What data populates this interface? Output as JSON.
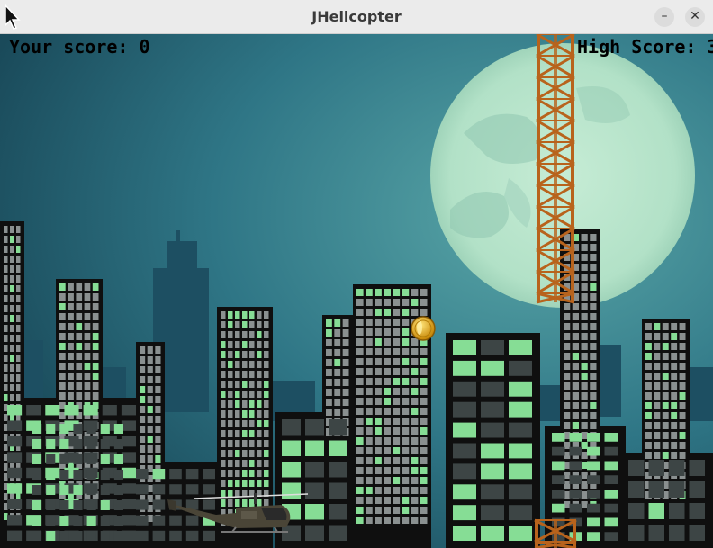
{
  "window": {
    "title": "JHelicopter",
    "minimize_icon": "minus-icon",
    "close_icon": "x-icon"
  },
  "hud": {
    "score_label": "Your score: 0",
    "high_score_label": "High Score: 3"
  },
  "colors": {
    "sky": "#2c6f80",
    "moon": "#b8e4cc",
    "buildings": "#0f0f0f",
    "lit_window": "#86dd95",
    "girder": "#b8631c",
    "coin": "#e6b319"
  },
  "icons": [
    "arrow-cursor-icon",
    "minus-icon",
    "x-icon",
    "coin-icon",
    "helicopter-icon"
  ]
}
